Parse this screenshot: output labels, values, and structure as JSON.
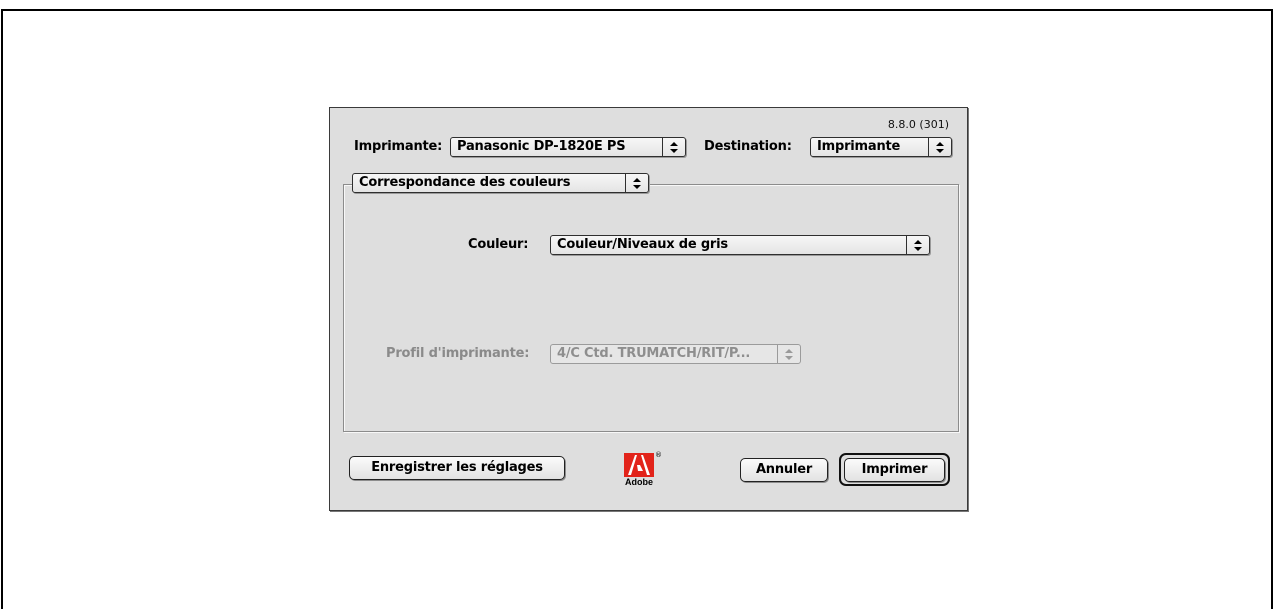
{
  "dialog": {
    "version": "8.8.0 (301)",
    "printer_label": "Imprimante:",
    "printer_value": "Panasonic DP-1820E PS",
    "destination_label": "Destination:",
    "destination_value": "Imprimante",
    "panel_value": "Correspondance des couleurs",
    "color_label": "Couleur:",
    "color_value": "Couleur/Niveaux de gris",
    "profile_label": "Profil d'imprimante:",
    "profile_value": "4/C Ctd. TRUMATCH/RIT/P...",
    "save_settings_button": "Enregistrer les réglages",
    "cancel_button": "Annuler",
    "print_button": "Imprimer",
    "logo_text": "Adobe",
    "logo_mark": "®"
  },
  "colors": {
    "dialog_bg": "#dedede",
    "adobe_red": "#e2231a",
    "disabled_text": "#8a8a8a"
  },
  "icons": [
    "updown-arrows-icon",
    "adobe-logo-icon"
  ]
}
